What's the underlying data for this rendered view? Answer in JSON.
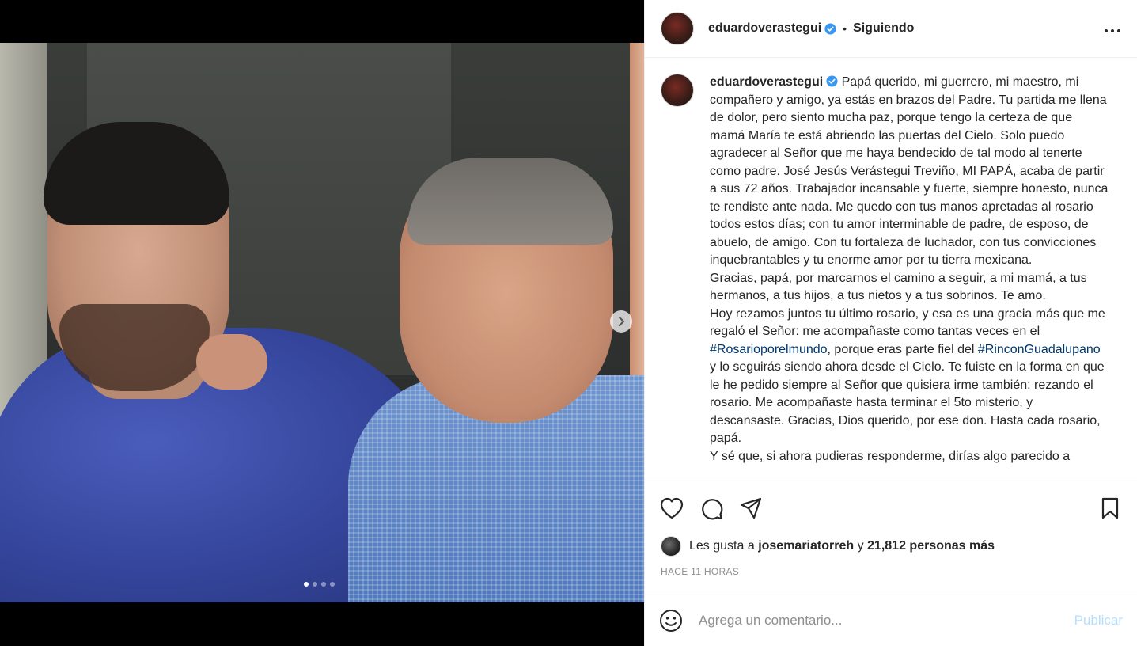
{
  "post": {
    "username": "eduardoverastegui",
    "follow_status": "Siguiendo",
    "header_separator": "•",
    "more_label": "•••",
    "media": {
      "carousel_count": 4,
      "active_index": 0
    }
  },
  "caption": {
    "username": "eduardoverastegui",
    "text_1": "Papá querido, mi guerrero, mi maestro, mi compañero y amigo, ya estás en brazos del Padre. Tu partida me llena de dolor, pero siento mucha paz, porque tengo la certeza de que mamá María te está abriendo las puertas del Cielo. Solo puedo agradecer al Señor que me haya bendecido de tal modo al tenerte como padre. José Jesús Verástegui Treviño, MI PAPÁ, acaba de partir a sus 72 años. Trabajador incansable y fuerte, siempre honesto, nunca te rendiste ante nada. Me quedo con tus manos apretadas al rosario todos estos días; con tu amor interminable de padre, de esposo, de abuelo, de amigo. Con tu fortaleza de luchador, con tus convicciones inquebrantables y tu enorme amor por tu tierra mexicana.",
    "text_2": "Gracias, papá, por marcarnos el camino a seguir, a mi mamá, a tus hermanos, a tus hijos, a tus nietos y a tus sobrinos. Te amo.",
    "text_3a": "Hoy rezamos juntos tu último rosario, y esa es una gracia más que me regaló el Señor: me acompañaste como tantas veces en el ",
    "hashtag_1": "#Rosarioporelmundo",
    "text_3b": ", porque eras parte fiel del ",
    "hashtag_2": "#RinconGuadalupano",
    "text_3c": " y lo seguirás siendo ahora desde el Cielo. Te fuiste en la forma en que le he pedido siempre al Señor que quisiera irme también: rezando el rosario. Me acompañaste hasta terminar el 5to misterio, y descansaste. Gracias, Dios querido, por ese don. Hasta cada rosario, papá.",
    "text_4": "Y sé que, si ahora pudieras responderme, dirías algo parecido a"
  },
  "likes": {
    "prefix": "Les gusta a",
    "user": "josemariatorreh",
    "connector": "y",
    "count_text": "21,812 personas más"
  },
  "timestamp": "HACE 11 HORAS",
  "comment": {
    "placeholder": "Agrega un comentario...",
    "publish_label": "Publicar"
  },
  "colors": {
    "hashtag": "#00376b",
    "verified": "#3897f0",
    "publish_disabled": "#b2dffc",
    "muted": "#8e8e8e"
  }
}
